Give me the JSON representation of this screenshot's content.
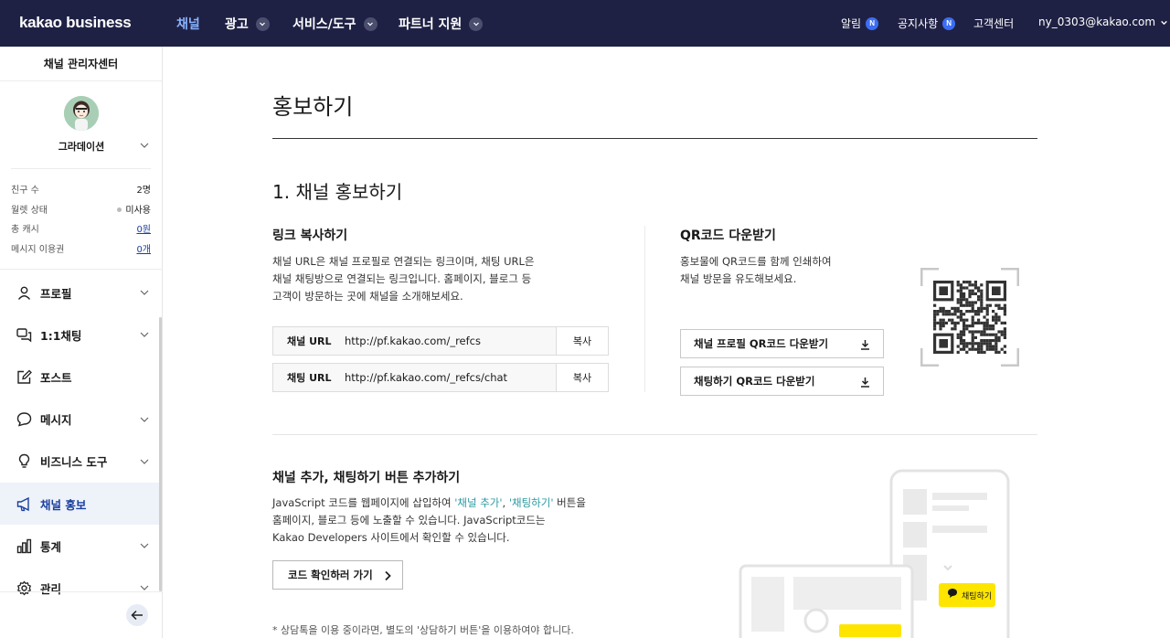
{
  "topbar": {
    "logo": "kakao business",
    "nav": [
      {
        "label": "채널"
      },
      {
        "label": "광고"
      },
      {
        "label": "서비스/도구"
      },
      {
        "label": "파트너 지원"
      }
    ],
    "right": {
      "alarm": "알림",
      "notice": "공지사항",
      "badge": "N",
      "support": "고객센터",
      "account": "ny_0303@kakao.com"
    }
  },
  "sidebar": {
    "title": "채널 관리자센터",
    "profile_name": "그라데이션",
    "stats": [
      {
        "label": "친구 수",
        "value": "2명"
      },
      {
        "label": "월렛 상태",
        "value": "미사용"
      },
      {
        "label": "총 캐시",
        "value": "0원"
      },
      {
        "label": "메시지 이용권",
        "value": "0개"
      }
    ],
    "menu": [
      {
        "label": "프로필"
      },
      {
        "label": "1:1채팅"
      },
      {
        "label": "포스트"
      },
      {
        "label": "메시지"
      },
      {
        "label": "비즈니스 도구"
      },
      {
        "label": "채널 홍보"
      },
      {
        "label": "통계"
      },
      {
        "label": "관리"
      }
    ]
  },
  "main": {
    "page_title": "홍보하기",
    "section_title": "1. 채널 홍보하기",
    "link_copy": {
      "heading": "링크 복사하기",
      "desc_lines": [
        "채널 URL은 채널 프로필로 연결되는 링크이며, 채팅 URL은",
        "채널 채팅방으로 연결되는 링크입니다. 홈페이지, 블로그 등",
        "고객이 방문하는 곳에 채널을 소개해보세요."
      ],
      "rows": [
        {
          "label": "채널 URL",
          "url": "http://pf.kakao.com/_refcs",
          "button": "복사"
        },
        {
          "label": "채팅 URL",
          "url": "http://pf.kakao.com/_refcs/chat",
          "button": "복사"
        }
      ]
    },
    "qr": {
      "heading": "QR코드 다운받기",
      "desc_lines": [
        "홍보물에 QR코드를 함께 인쇄하여",
        "채널 방문을 유도해보세요."
      ],
      "buttons": [
        "채널 프로필 QR코드 다운받기",
        "채팅하기 QR코드 다운받기"
      ]
    },
    "add_button": {
      "heading": "채널 추가, 채팅하기 버튼 추가하기",
      "line1_pre": "JavaScript 코드를 웹페이지에 삽입하여 ",
      "line1_hl1": "'채널 추가'",
      "line1_sep": ", ",
      "line1_hl2": "'채팅하기'",
      "line1_post": " 버튼을",
      "line2": "홈페이지, 블로그 등에 노출할 수 있습니다. JavaScript코드는",
      "line3": "Kakao Developers 사이트에서 확인할 수 있습니다.",
      "button": "코드 확인하러 가기",
      "illus_chat": "채팅하기",
      "note": "*  상담톡을 이용 중이라면, 별도의 '상담하기 버튼'을 이용하여야 합니다."
    }
  },
  "colors": {
    "nav_bg": "#1f2144",
    "active_nav": "#8ab4ff",
    "accent": "#1a3f9e",
    "highlight": "#2a9aa2",
    "badge": "#3b6ef5",
    "yellow": "#fee500"
  }
}
